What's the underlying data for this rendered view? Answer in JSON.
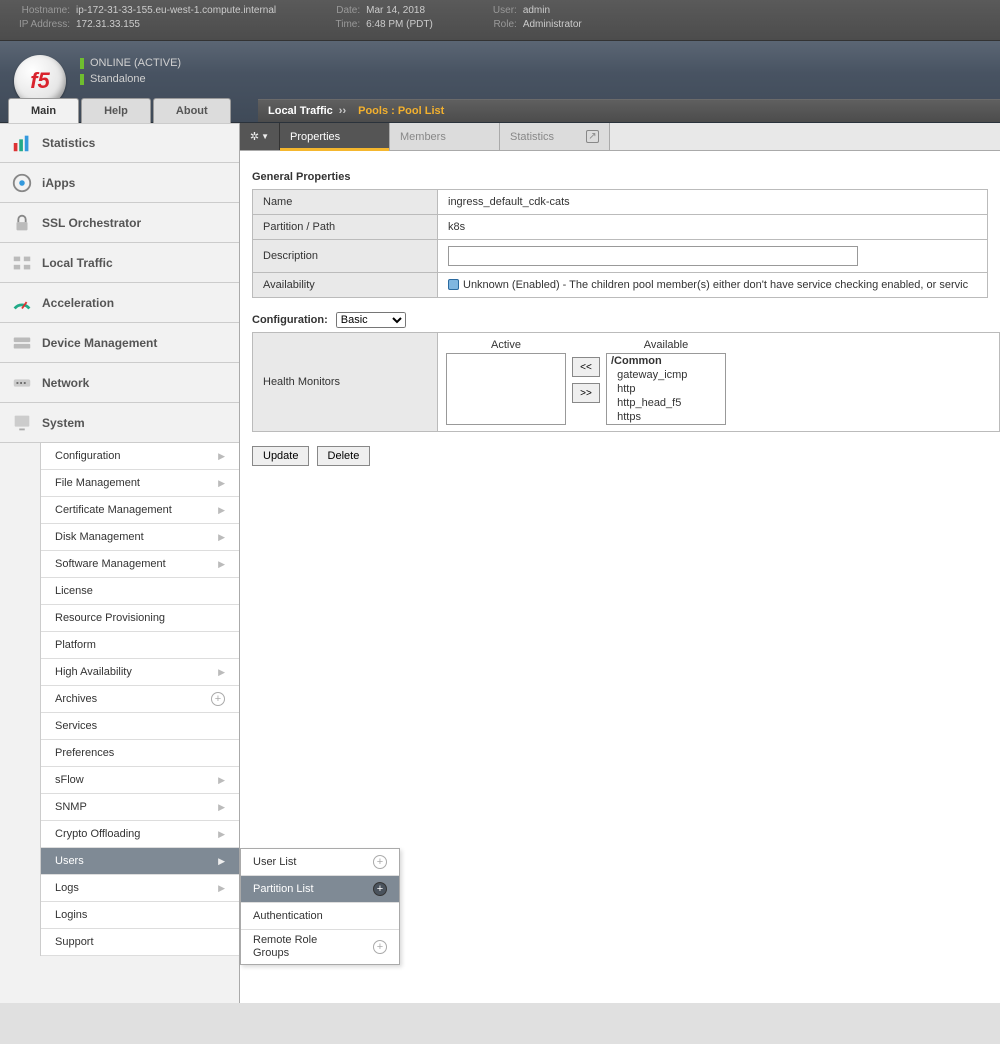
{
  "statusbar": {
    "hostname_label": "Hostname:",
    "hostname": "ip-172-31-33-155.eu-west-1.compute.internal",
    "ip_label": "IP Address:",
    "ip": "172.31.33.155",
    "date_label": "Date:",
    "date": "Mar 14, 2018",
    "time_label": "Time:",
    "time": "6:48 PM (PDT)",
    "user_label": "User:",
    "user": "admin",
    "role_label": "Role:",
    "role": "Administrator"
  },
  "header": {
    "logo_text": "f5",
    "status_line1": "ONLINE (ACTIVE)",
    "status_line2": "Standalone",
    "tabs": {
      "main": "Main",
      "help": "Help",
      "about": "About"
    }
  },
  "breadcrumb": {
    "root": "Local Traffic",
    "separator": "››",
    "leaf": "Pools : Pool List"
  },
  "nav": {
    "statistics": "Statistics",
    "iapps": "iApps",
    "ssl_orchestrator": "SSL Orchestrator",
    "local_traffic": "Local Traffic",
    "acceleration": "Acceleration",
    "device_management": "Device Management",
    "network": "Network",
    "system": "System"
  },
  "system_sub": [
    "Configuration",
    "File Management",
    "Certificate Management",
    "Disk Management",
    "Software Management",
    "License",
    "Resource Provisioning",
    "Platform",
    "High Availability",
    "Archives",
    "Services",
    "Preferences",
    "sFlow",
    "SNMP",
    "Crypto Offloading",
    "Users",
    "Logs",
    "Logins",
    "Support"
  ],
  "users_fly": {
    "user_list": "User List",
    "partition_list": "Partition List",
    "authentication": "Authentication",
    "remote_role_groups": "Remote Role Groups"
  },
  "content_tabs": {
    "properties": "Properties",
    "members": "Members",
    "statistics": "Statistics"
  },
  "general": {
    "heading": "General Properties",
    "name_label": "Name",
    "name_value": "ingress_default_cdk-cats",
    "partition_label": "Partition / Path",
    "partition_value": "k8s",
    "description_label": "Description",
    "description_value": "",
    "availability_label": "Availability",
    "availability_value": "Unknown (Enabled) - The children pool member(s) either don't have service checking enabled, or servic"
  },
  "config": {
    "label": "Configuration:",
    "level": "Basic",
    "hm_label": "Health Monitors",
    "active_header": "Active",
    "available_header": "Available",
    "available_group": "/Common",
    "available": [
      "gateway_icmp",
      "http",
      "http_head_f5",
      "https"
    ],
    "move_left": "<<",
    "move_right": ">>"
  },
  "buttons": {
    "update": "Update",
    "delete": "Delete"
  }
}
